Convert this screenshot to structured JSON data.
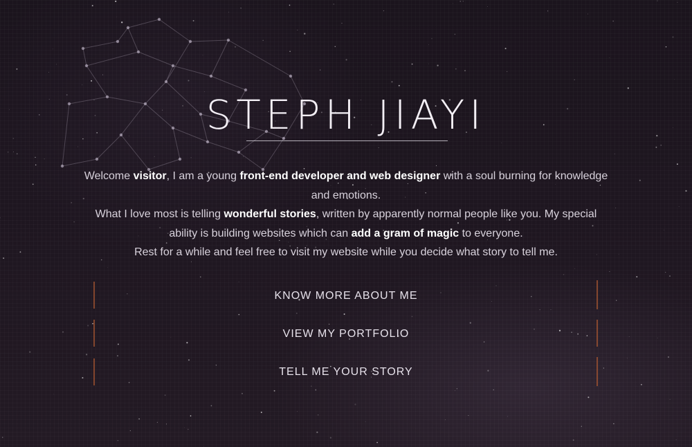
{
  "header": {
    "title": "STEPH JIAYI"
  },
  "intro": {
    "p1_a": "Welcome ",
    "p1_b": "visitor",
    "p1_c": ", I am a young ",
    "p1_d": "front-end developer and web designer",
    "p1_e": " with a soul burning for knowledge and emotions.",
    "p2_a": "What I love most is telling ",
    "p2_b": "wonderful stories",
    "p2_c": ", written by apparently normal people like you. My special ability is building websites which can ",
    "p2_d": "add a gram of magic",
    "p2_e": " to everyone.",
    "p3": "Rest for a while and feel free to visit my website while you decide what story to tell me."
  },
  "menu": {
    "items": [
      {
        "label": "KNOW MORE ABOUT ME"
      },
      {
        "label": "VIEW MY PORTFOLIO"
      },
      {
        "label": "TELL ME YOUR STORY"
      }
    ]
  },
  "colors": {
    "background": "#1e1620",
    "accent_line": "#a55532",
    "text": "#e9e4ec"
  }
}
